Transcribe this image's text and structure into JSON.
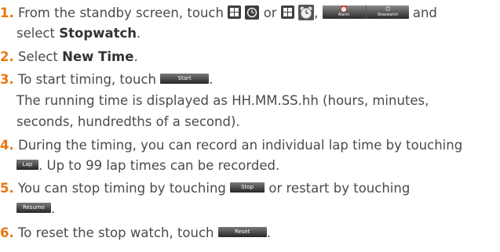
{
  "steps": [
    {
      "number": "1.",
      "text_a": "From the standby screen, touch",
      "sep_or": "or",
      "sep_comma": ",",
      "text_b": "and",
      "line2_a": "select",
      "line2_bold": "Stopwatch",
      "line2_end": "."
    },
    {
      "number": "2.",
      "text_a": "Select",
      "bold": "New Time",
      "end": "."
    },
    {
      "number": "3.",
      "text_a": "To start timing, touch",
      "end": ".",
      "line2": "The running time is displayed as HH.MM.SS.hh (hours, minutes,",
      "line3": "seconds, hundredths of a second)."
    },
    {
      "number": "4.",
      "text_a": "During the timing, you can record an individual lap time by touching",
      "line2": ". Up to 99 lap times can be recorded."
    },
    {
      "number": "5.",
      "text_a": "You can stop timing by touching",
      "text_b": "or restart by touching",
      "end": "."
    },
    {
      "number": "6.",
      "text_a": "To reset the stop watch, touch",
      "end": "."
    }
  ],
  "buttons": {
    "start": "Start",
    "lap": "Lap",
    "stop": "Stop",
    "resume": "Resume",
    "reset": "Reset",
    "alarm_tab": "Alarm",
    "stopwatch_tab": "Stopwatch"
  },
  "icons": [
    "menu-grid-icon",
    "clock-icon",
    "alarm-clock-icon",
    "stopwatch-icon"
  ],
  "colors": {
    "step_number": "#e8770e",
    "text": "#4a4a4a",
    "button": "#262626"
  }
}
